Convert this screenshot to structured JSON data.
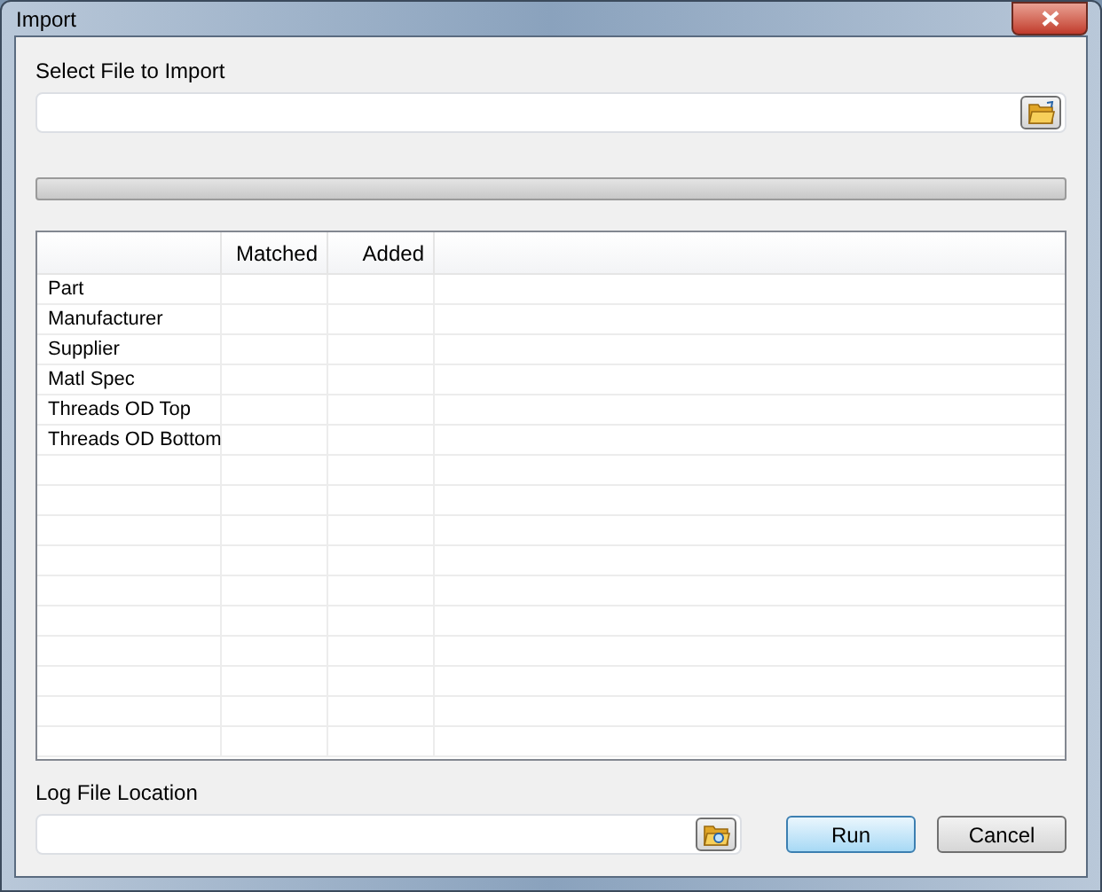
{
  "window": {
    "title": "Import"
  },
  "file_select": {
    "label": "Select File to Import"
  },
  "progress": {
    "level": 0
  },
  "table": {
    "columns": [
      "Matched",
      "Added"
    ],
    "rows": [
      {
        "name": "Part"
      },
      {
        "name": "Manufacturer"
      },
      {
        "name": "Supplier"
      },
      {
        "name": "Matl Spec"
      },
      {
        "name": "Threads OD Top"
      },
      {
        "name": "Threads OD Bottom"
      }
    ]
  },
  "log_file": {
    "label": "Log File Location"
  },
  "buttons": [
    {
      "label": "Run",
      "default": true
    },
    {
      "label": "Cancel",
      "default": false
    }
  ]
}
